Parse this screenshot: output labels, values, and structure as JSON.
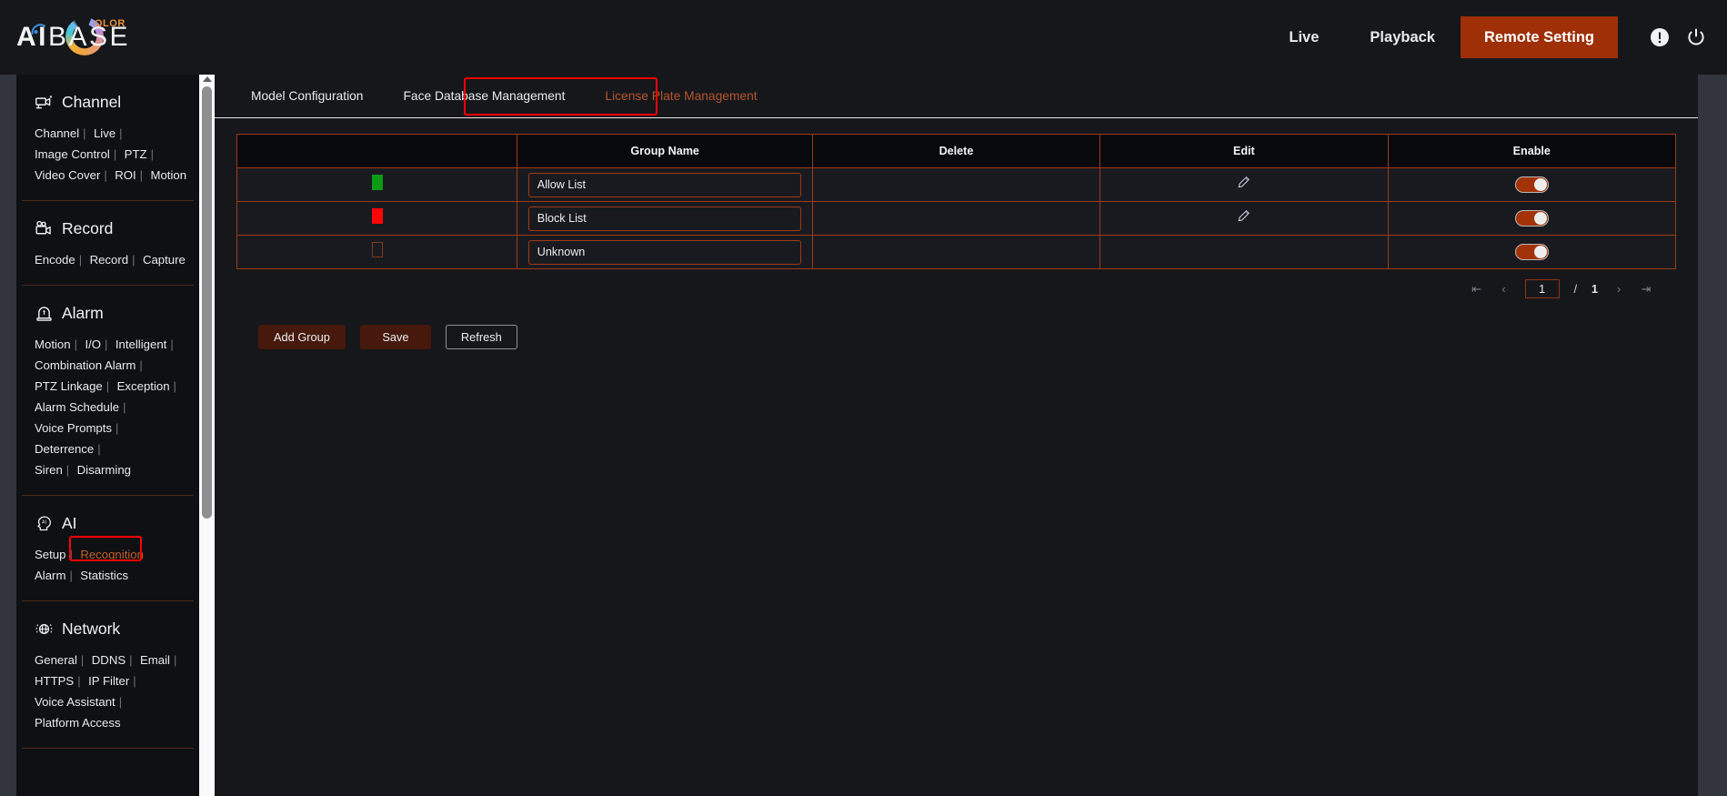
{
  "header": {
    "logo": {
      "ai": "AI",
      "base": "BASE",
      "olor": "OLOR",
      "arc_icon": "wifi-arc-icon"
    },
    "nav": [
      {
        "label": "Live",
        "active": false
      },
      {
        "label": "Playback",
        "active": false
      },
      {
        "label": "Remote Setting",
        "active": true
      }
    ],
    "icons": [
      {
        "name": "info-icon"
      },
      {
        "name": "power-icon"
      }
    ],
    "accent_color": "#9e2f07"
  },
  "sidebar": {
    "sections": [
      {
        "title": "Channel",
        "icon": "camera-icon",
        "links": [
          "Channel",
          "Live",
          "Image Control",
          "PTZ",
          "Video Cover",
          "ROI",
          "Motion"
        ]
      },
      {
        "title": "Record",
        "icon": "video-camera-icon",
        "links": [
          "Encode",
          "Record",
          "Capture"
        ]
      },
      {
        "title": "Alarm",
        "icon": "siren-icon",
        "links": [
          "Motion",
          "I/O",
          "Intelligent",
          "Combination Alarm",
          "PTZ Linkage",
          "Exception",
          "Alarm Schedule",
          "Voice Prompts",
          "Deterrence",
          "Siren",
          "Disarming"
        ]
      },
      {
        "title": "AI",
        "icon": "ai-head-icon",
        "links": [
          "Setup",
          "Recognition",
          "Alarm",
          "Statistics"
        ],
        "active_link": "Recognition"
      },
      {
        "title": "Network",
        "icon": "globe-icon",
        "links": [
          "General",
          "DDNS",
          "Email",
          "HTTPS",
          "IP Filter",
          "Voice Assistant",
          "Platform Access"
        ]
      }
    ],
    "highlight_color": "#ff0000",
    "active_link_color": "#c25e2a"
  },
  "tabs": [
    {
      "label": "Model Configuration",
      "active": false
    },
    {
      "label": "Face Database Management",
      "active": false
    },
    {
      "label": "License Plate Management",
      "active": true,
      "highlighted": true
    }
  ],
  "table": {
    "columns": [
      "",
      "Group Name",
      "Delete",
      "Edit",
      "Enable"
    ],
    "rows": [
      {
        "swatch_color": "#0c9b14",
        "group_name": "Allow List",
        "delete": "",
        "edit_icon": "pencil-icon",
        "has_edit": true,
        "enabled": true
      },
      {
        "swatch_color": "#fb0606",
        "group_name": "Block List",
        "delete": "",
        "edit_icon": "pencil-icon",
        "has_edit": true,
        "enabled": true
      },
      {
        "swatch_color": "transparent",
        "group_name": "Unknown",
        "delete": "",
        "edit_icon": "",
        "has_edit": false,
        "enabled": true
      }
    ]
  },
  "pagination": {
    "first_icon": "first-page-icon",
    "prev_icon": "prev-page-icon",
    "current_page": "1",
    "separator": "/",
    "total_pages": "1",
    "next_icon": "next-page-icon",
    "last_icon": "last-page-icon"
  },
  "buttons": [
    {
      "label": "Add Group",
      "style": "primary"
    },
    {
      "label": "Save",
      "style": "primary"
    },
    {
      "label": "Refresh",
      "style": "ghost"
    }
  ]
}
